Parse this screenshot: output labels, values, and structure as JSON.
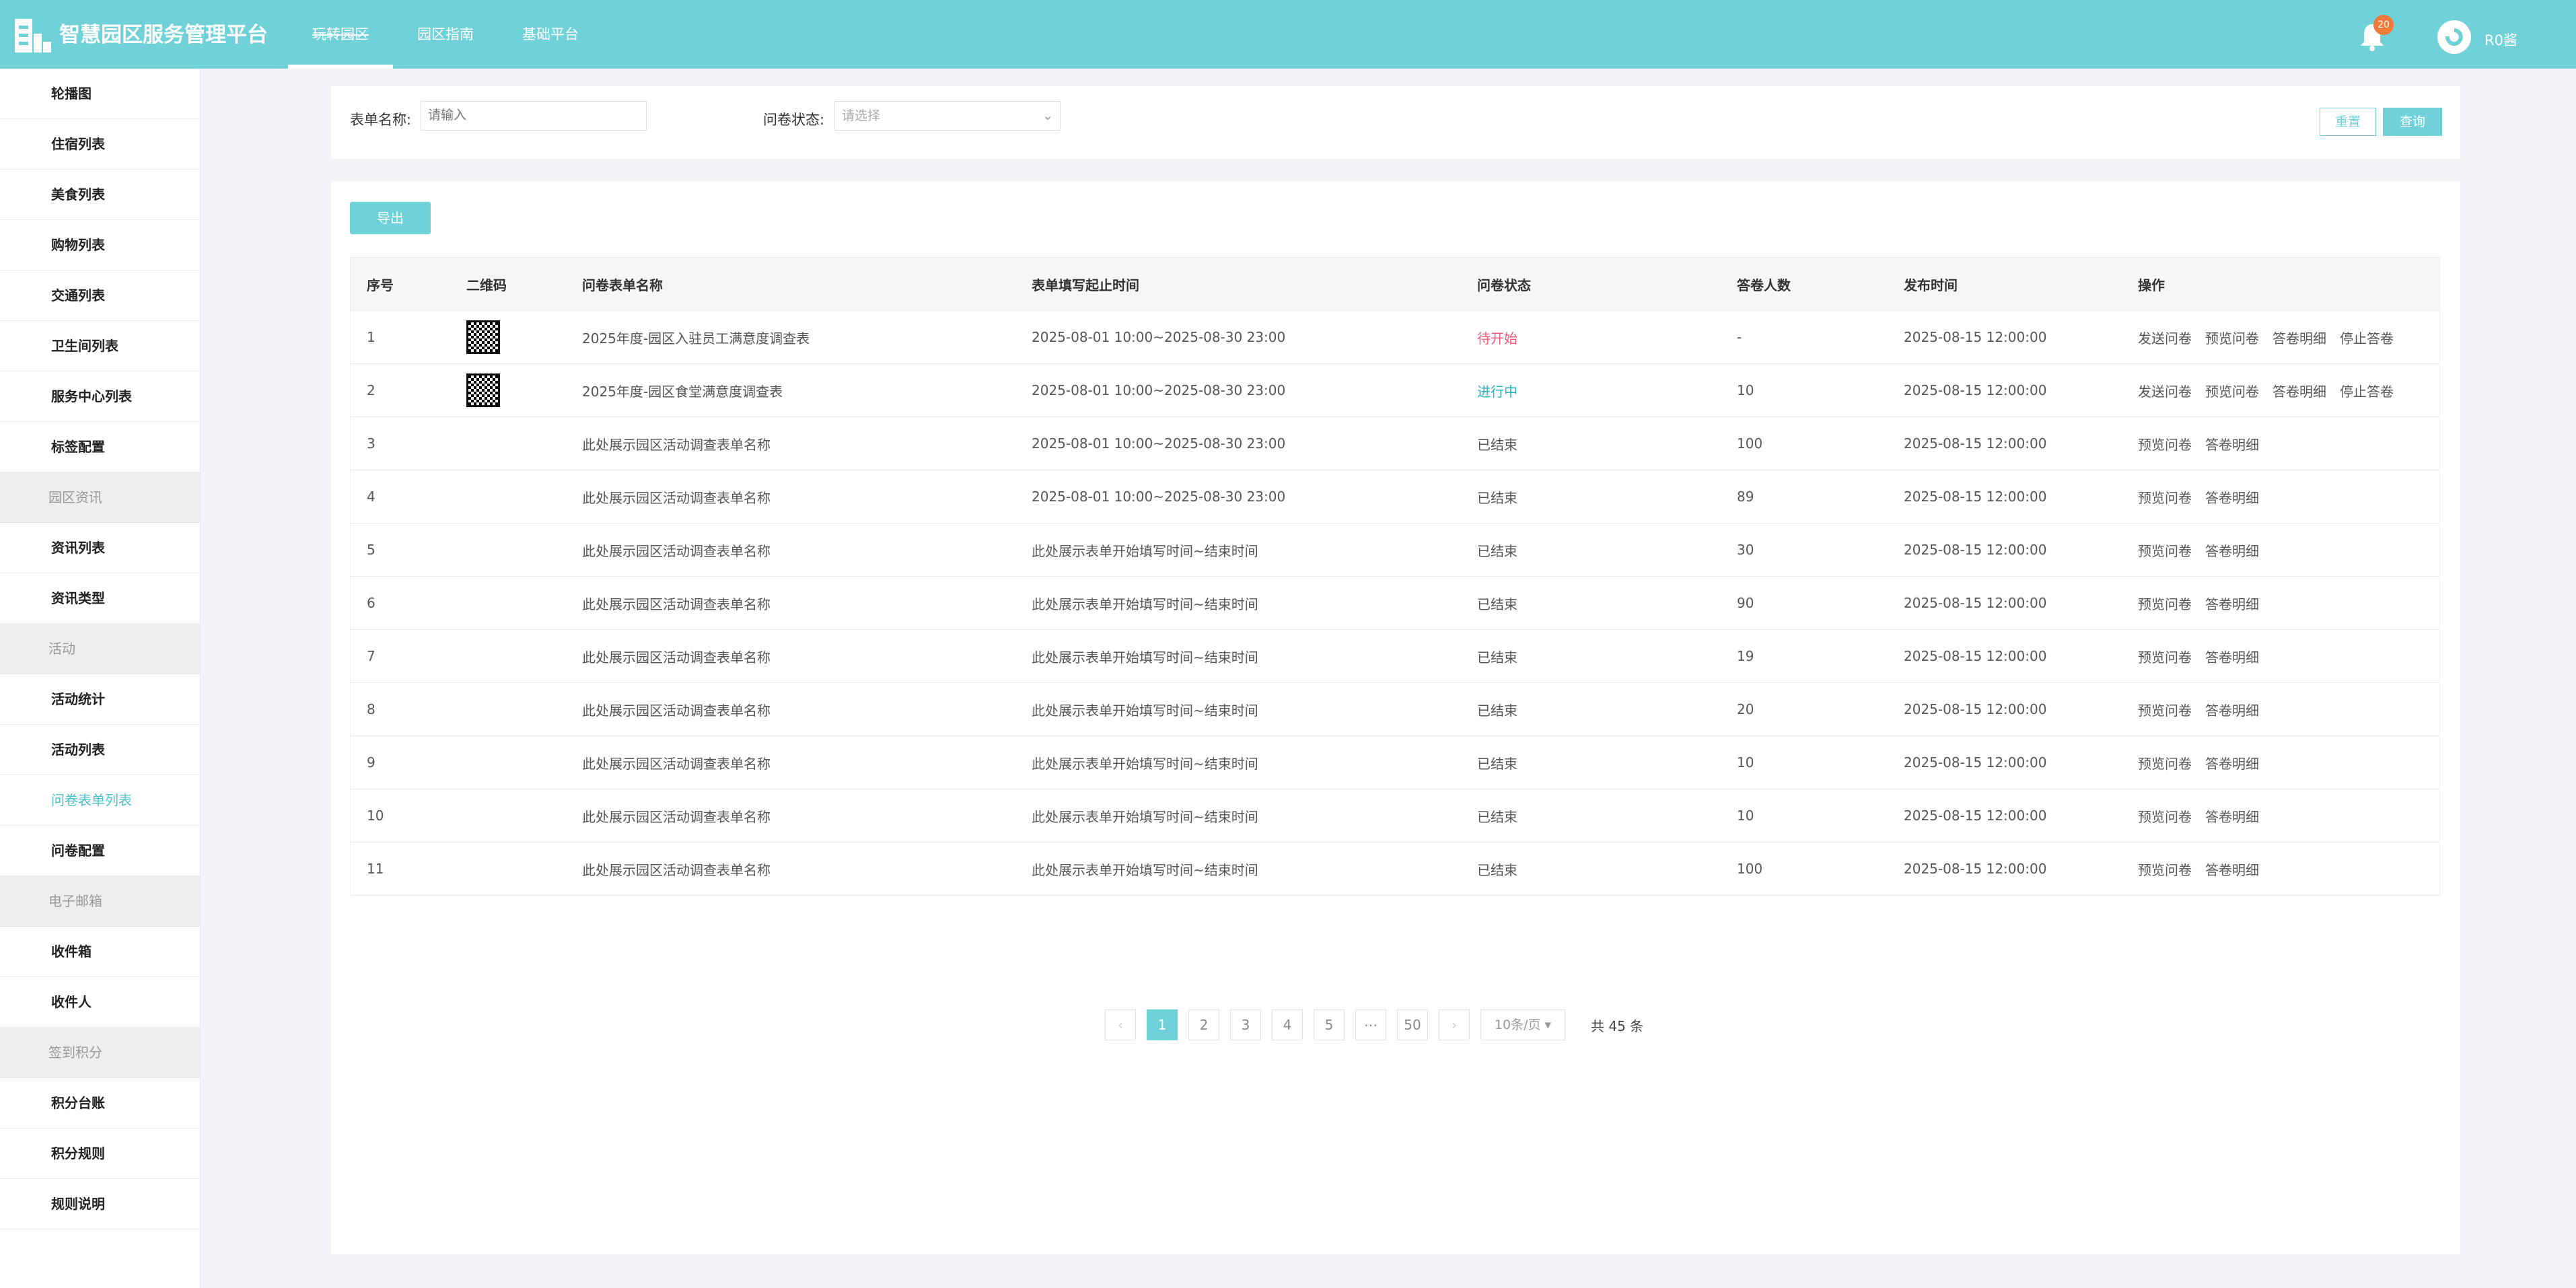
{
  "header": {
    "title": "智慧园区服务管理平台",
    "nav": [
      {
        "label": "玩转园区",
        "active": true
      },
      {
        "label": "园区指南",
        "active": false
      },
      {
        "label": "基础平台",
        "active": false
      }
    ],
    "notification_count": "20",
    "username": "R0酱",
    "accent_color": "#70d2d8"
  },
  "sidebar": {
    "items": [
      {
        "label": "轮播图",
        "type": "item"
      },
      {
        "label": "住宿列表",
        "type": "item"
      },
      {
        "label": "美食列表",
        "type": "item"
      },
      {
        "label": "购物列表",
        "type": "item"
      },
      {
        "label": "交通列表",
        "type": "item"
      },
      {
        "label": "卫生间列表",
        "type": "item"
      },
      {
        "label": "服务中心列表",
        "type": "item"
      },
      {
        "label": "标签配置",
        "type": "item"
      },
      {
        "label": "园区资讯",
        "type": "group"
      },
      {
        "label": "资讯列表",
        "type": "item"
      },
      {
        "label": "资讯类型",
        "type": "item"
      },
      {
        "label": "活动",
        "type": "group"
      },
      {
        "label": "活动统计",
        "type": "item"
      },
      {
        "label": "活动列表",
        "type": "item"
      },
      {
        "label": "问卷表单列表",
        "type": "item",
        "active": true
      },
      {
        "label": "问卷配置",
        "type": "item"
      },
      {
        "label": "电子邮箱",
        "type": "group"
      },
      {
        "label": "收件箱",
        "type": "item"
      },
      {
        "label": "收件人",
        "type": "item"
      },
      {
        "label": "签到积分",
        "type": "group"
      },
      {
        "label": "积分台账",
        "type": "item"
      },
      {
        "label": "积分规则",
        "type": "item"
      },
      {
        "label": "规则说明",
        "type": "item"
      }
    ]
  },
  "filter": {
    "name_label": "表单名称:",
    "name_placeholder": "请输入",
    "status_label": "问卷状态:",
    "status_placeholder": "请选择",
    "reset_label": "重置",
    "query_label": "查询"
  },
  "toolbar": {
    "export_label": "导出"
  },
  "table": {
    "headers": [
      "序号",
      "二维码",
      "问卷表单名称",
      "表单填写起止时间",
      "问卷状态",
      "答卷人数",
      "发布时间",
      "操作"
    ],
    "rows": [
      {
        "no": "1",
        "qr": true,
        "name": "2025年度-园区入驻员工满意度调查表",
        "period": "2025-08-01 10:00~2025-08-30 23:00",
        "status": "待开始",
        "status_type": "pending",
        "count": "-",
        "published": "2025-08-15 12:00:00",
        "ops": [
          "发送问卷",
          "预览问卷",
          "答卷明细",
          "停止答卷"
        ]
      },
      {
        "no": "2",
        "qr": true,
        "name": "2025年度-园区食堂满意度调查表",
        "period": "2025-08-01 10:00~2025-08-30 23:00",
        "status": "进行中",
        "status_type": "progress",
        "count": "10",
        "published": "2025-08-15 12:00:00",
        "ops": [
          "发送问卷",
          "预览问卷",
          "答卷明细",
          "停止答卷"
        ]
      },
      {
        "no": "3",
        "qr": false,
        "name": "此处展示园区活动调查表单名称",
        "period": "2025-08-01 10:00~2025-08-30 23:00",
        "status": "已结束",
        "status_type": "ended",
        "count": "100",
        "published": "2025-08-15 12:00:00",
        "ops": [
          "预览问卷",
          "答卷明细"
        ]
      },
      {
        "no": "4",
        "qr": false,
        "name": "此处展示园区活动调查表单名称",
        "period": "2025-08-01 10:00~2025-08-30 23:00",
        "status": "已结束",
        "status_type": "ended",
        "count": "89",
        "published": "2025-08-15 12:00:00",
        "ops": [
          "预览问卷",
          "答卷明细"
        ]
      },
      {
        "no": "5",
        "qr": false,
        "name": "此处展示园区活动调查表单名称",
        "period": "此处展示表单开始填写时间~结束时间",
        "status": "已结束",
        "status_type": "ended",
        "count": "30",
        "published": "2025-08-15 12:00:00",
        "ops": [
          "预览问卷",
          "答卷明细"
        ]
      },
      {
        "no": "6",
        "qr": false,
        "name": "此处展示园区活动调查表单名称",
        "period": "此处展示表单开始填写时间~结束时间",
        "status": "已结束",
        "status_type": "ended",
        "count": "90",
        "published": "2025-08-15 12:00:00",
        "ops": [
          "预览问卷",
          "答卷明细"
        ]
      },
      {
        "no": "7",
        "qr": false,
        "name": "此处展示园区活动调查表单名称",
        "period": "此处展示表单开始填写时间~结束时间",
        "status": "已结束",
        "status_type": "ended",
        "count": "19",
        "published": "2025-08-15 12:00:00",
        "ops": [
          "预览问卷",
          "答卷明细"
        ]
      },
      {
        "no": "8",
        "qr": false,
        "name": "此处展示园区活动调查表单名称",
        "period": "此处展示表单开始填写时间~结束时间",
        "status": "已结束",
        "status_type": "ended",
        "count": "20",
        "published": "2025-08-15 12:00:00",
        "ops": [
          "预览问卷",
          "答卷明细"
        ]
      },
      {
        "no": "9",
        "qr": false,
        "name": "此处展示园区活动调查表单名称",
        "period": "此处展示表单开始填写时间~结束时间",
        "status": "已结束",
        "status_type": "ended",
        "count": "10",
        "published": "2025-08-15 12:00:00",
        "ops": [
          "预览问卷",
          "答卷明细"
        ]
      },
      {
        "no": "10",
        "qr": false,
        "name": "此处展示园区活动调查表单名称",
        "period": "此处展示表单开始填写时间~结束时间",
        "status": "已结束",
        "status_type": "ended",
        "count": "10",
        "published": "2025-08-15 12:00:00",
        "ops": [
          "预览问卷",
          "答卷明细"
        ]
      },
      {
        "no": "11",
        "qr": false,
        "name": "此处展示园区活动调查表单名称",
        "period": "此处展示表单开始填写时间~结束时间",
        "status": "已结束",
        "status_type": "ended",
        "count": "100",
        "published": "2025-08-15 12:00:00",
        "ops": [
          "预览问卷",
          "答卷明细"
        ]
      }
    ]
  },
  "pagination": {
    "prev": "‹",
    "pages": [
      "1",
      "2",
      "3",
      "4",
      "5",
      "⋯",
      "50"
    ],
    "current": "1",
    "next": "›",
    "page_size": "10条/页 ▾",
    "total": "共 45 条"
  }
}
